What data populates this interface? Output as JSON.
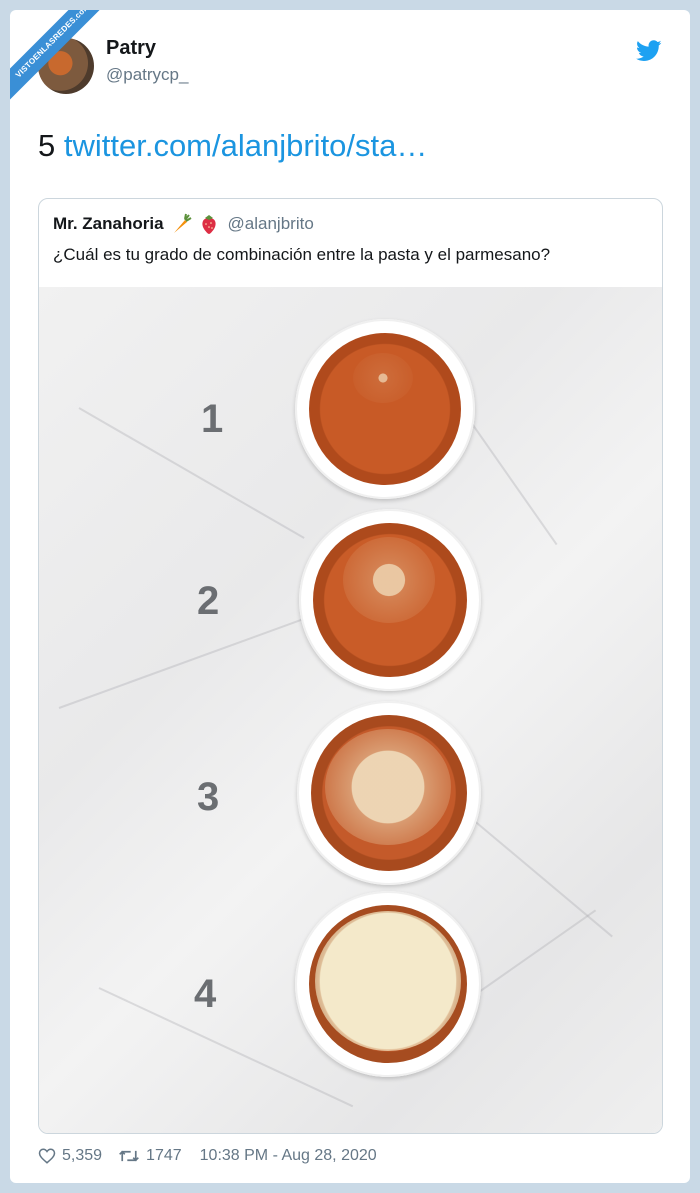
{
  "watermark": "VISTOENLASREDES.com",
  "author": {
    "name": "Patry",
    "handle": "@patrycp_"
  },
  "tweet": {
    "prefix": "5 ",
    "link_text": "twitter.com/alanjbrito/sta…"
  },
  "quoted": {
    "name": "Mr. Zanahoria",
    "emojis": [
      "carrot-icon",
      "strawberry-icon"
    ],
    "handle": "@alanjbrito",
    "text": "¿Cuál es tu grado de combinación entre la pasta y el parmesano?"
  },
  "photo": {
    "labels": [
      "1",
      "2",
      "3",
      "4"
    ],
    "cheese_levels": [
      0.15,
      0.35,
      0.6,
      0.95
    ]
  },
  "footer": {
    "likes": "5,359",
    "retweets": "1747",
    "timestamp": "10:38 PM - Aug 28, 2020"
  },
  "colors": {
    "link": "#1b95e0",
    "twitter_blue": "#1da1f2",
    "muted": "#657786"
  }
}
